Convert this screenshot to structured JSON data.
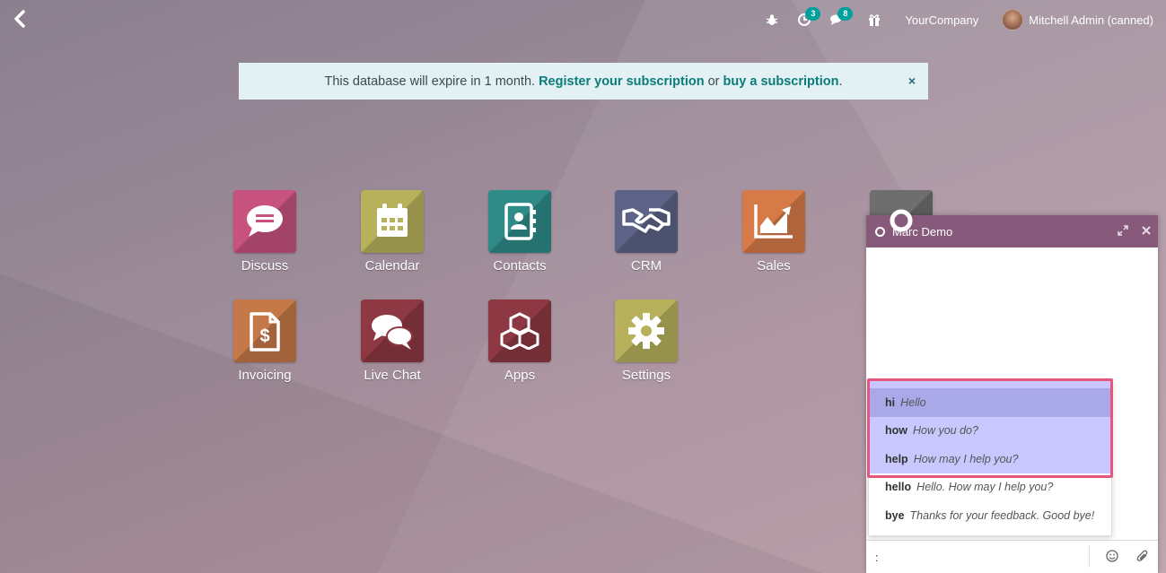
{
  "topbar": {
    "activity_badge": "3",
    "messages_badge": "8",
    "company": "YourCompany",
    "user": "Mitchell Admin (canned)"
  },
  "banner": {
    "text_before": "This database will expire in 1 month. ",
    "register_link": "Register your subscription",
    "text_mid": " or ",
    "buy_link": "buy a subscription",
    "text_after": ".",
    "close": "×"
  },
  "apps": [
    {
      "label": "Discuss",
      "color": "#c7527e",
      "icon": "chat-bubble-icon"
    },
    {
      "label": "Calendar",
      "color": "#b7b15b",
      "icon": "calendar-icon"
    },
    {
      "label": "Contacts",
      "color": "#2e8b88",
      "icon": "address-book-icon"
    },
    {
      "label": "CRM",
      "color": "#5c6386",
      "icon": "handshake-icon"
    },
    {
      "label": "Sales",
      "color": "#d67a48",
      "icon": "chart-area-icon"
    },
    {
      "label": "Invoicing",
      "color": "#c57948",
      "icon": "invoice-icon"
    },
    {
      "label": "Live Chat",
      "color": "#8d3842",
      "icon": "comments-icon"
    },
    {
      "label": "Apps",
      "color": "#8d3842",
      "icon": "cubes-icon"
    },
    {
      "label": "Settings",
      "color": "#b7b15b",
      "icon": "gear-icon"
    }
  ],
  "chat": {
    "title": "Marc Demo",
    "composer_value": ":",
    "canned": [
      {
        "key": "hi",
        "value": "Hello"
      },
      {
        "key": "how",
        "value": "How you do?"
      },
      {
        "key": "help",
        "value": "How may I help you?"
      },
      {
        "key": "hello",
        "value": "Hello. How may I help you?"
      },
      {
        "key": "bye",
        "value": "Thanks for your feedback. Good bye!"
      }
    ]
  },
  "colors": {
    "primary": "#875a7b",
    "accent": "#00a09d",
    "highlight_border": "#e4567b"
  }
}
